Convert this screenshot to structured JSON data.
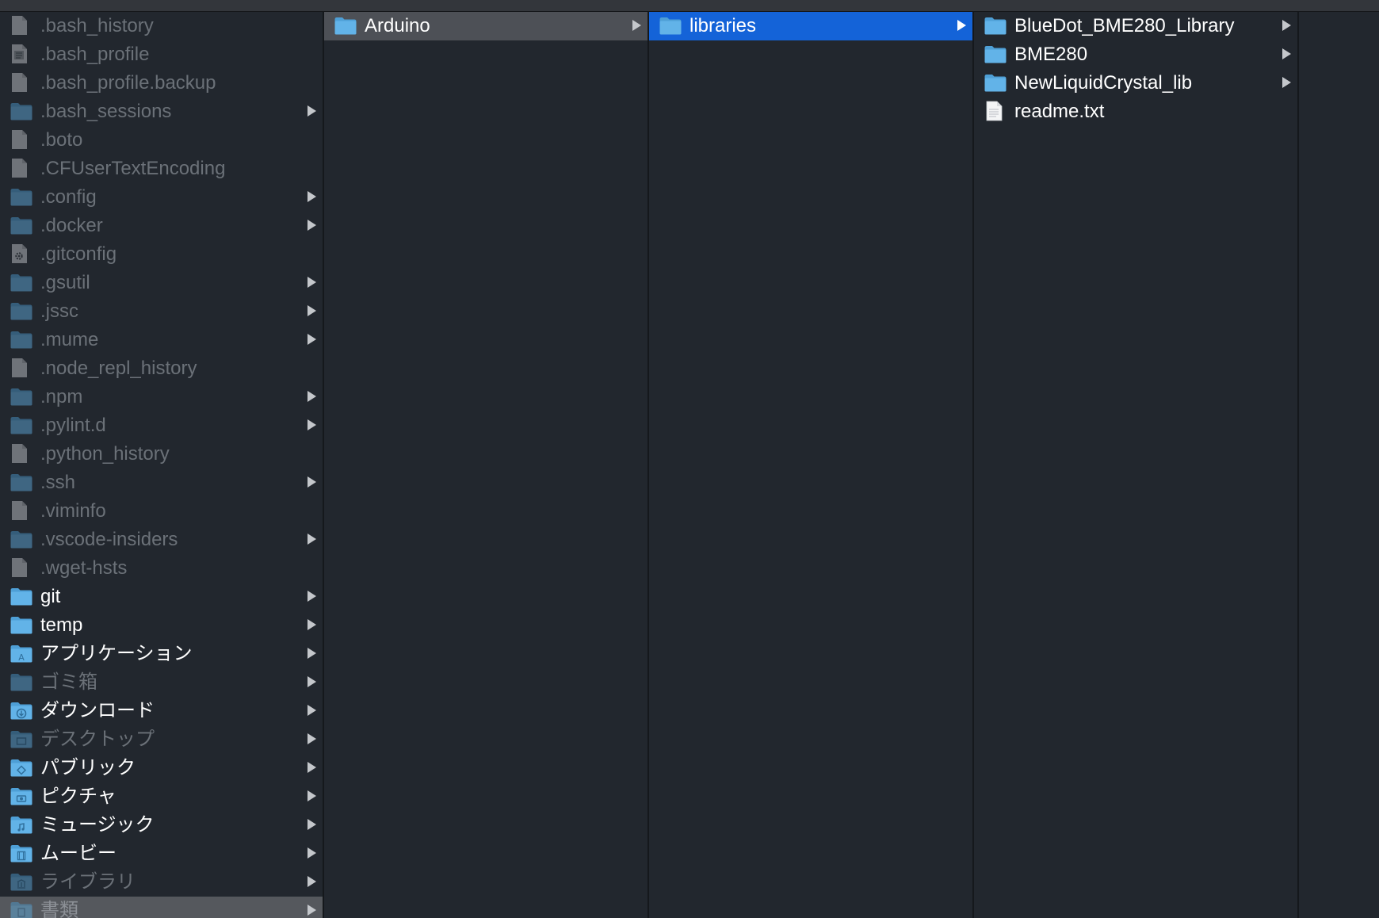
{
  "columns": [
    {
      "items": [
        {
          "name": ".bash_history",
          "kind": "doc",
          "hidden": true,
          "arrow": false
        },
        {
          "name": ".bash_profile",
          "kind": "text-doc",
          "hidden": true,
          "arrow": false
        },
        {
          "name": ".bash_profile.backup",
          "kind": "doc",
          "hidden": true,
          "arrow": false
        },
        {
          "name": ".bash_sessions",
          "kind": "folder",
          "hidden": true,
          "arrow": true
        },
        {
          "name": ".boto",
          "kind": "doc",
          "hidden": true,
          "arrow": false
        },
        {
          "name": ".CFUserTextEncoding",
          "kind": "doc",
          "hidden": true,
          "arrow": false
        },
        {
          "name": ".config",
          "kind": "folder",
          "hidden": true,
          "arrow": true
        },
        {
          "name": ".docker",
          "kind": "folder",
          "hidden": true,
          "arrow": true
        },
        {
          "name": ".gitconfig",
          "kind": "gear-doc",
          "hidden": true,
          "arrow": false
        },
        {
          "name": ".gsutil",
          "kind": "folder",
          "hidden": true,
          "arrow": true
        },
        {
          "name": ".jssc",
          "kind": "folder",
          "hidden": true,
          "arrow": true
        },
        {
          "name": ".mume",
          "kind": "folder",
          "hidden": true,
          "arrow": true
        },
        {
          "name": ".node_repl_history",
          "kind": "doc",
          "hidden": true,
          "arrow": false
        },
        {
          "name": ".npm",
          "kind": "folder",
          "hidden": true,
          "arrow": true
        },
        {
          "name": ".pylint.d",
          "kind": "folder",
          "hidden": true,
          "arrow": true
        },
        {
          "name": ".python_history",
          "kind": "doc",
          "hidden": true,
          "arrow": false
        },
        {
          "name": ".ssh",
          "kind": "folder",
          "hidden": true,
          "arrow": true
        },
        {
          "name": ".viminfo",
          "kind": "doc",
          "hidden": true,
          "arrow": false
        },
        {
          "name": ".vscode-insiders",
          "kind": "folder",
          "hidden": true,
          "arrow": true
        },
        {
          "name": ".wget-hsts",
          "kind": "doc",
          "hidden": true,
          "arrow": false
        },
        {
          "name": "git",
          "kind": "folder",
          "hidden": false,
          "arrow": true
        },
        {
          "name": "temp",
          "kind": "folder",
          "hidden": false,
          "arrow": true
        },
        {
          "name": "アプリケーション",
          "kind": "folder-apps",
          "hidden": false,
          "arrow": true
        },
        {
          "name": "ゴミ箱",
          "kind": "folder",
          "hidden": true,
          "arrow": true
        },
        {
          "name": "ダウンロード",
          "kind": "folder-downloads",
          "hidden": false,
          "arrow": true
        },
        {
          "name": "デスクトップ",
          "kind": "folder-desktop",
          "hidden": true,
          "arrow": true
        },
        {
          "name": "パブリック",
          "kind": "folder-public",
          "hidden": false,
          "arrow": true
        },
        {
          "name": "ピクチャ",
          "kind": "folder-pictures",
          "hidden": false,
          "arrow": true
        },
        {
          "name": "ミュージック",
          "kind": "folder-music",
          "hidden": false,
          "arrow": true
        },
        {
          "name": "ムービー",
          "kind": "folder-movies",
          "hidden": false,
          "arrow": true
        },
        {
          "name": "ライブラリ",
          "kind": "folder-library",
          "hidden": true,
          "arrow": true
        },
        {
          "name": "書類",
          "kind": "folder-documents",
          "hidden": true,
          "arrow": true,
          "selected": "bottom"
        }
      ]
    },
    {
      "items": [
        {
          "name": "Arduino",
          "kind": "folder",
          "hidden": false,
          "arrow": true,
          "selected": "gray"
        }
      ]
    },
    {
      "items": [
        {
          "name": "libraries",
          "kind": "folder",
          "hidden": false,
          "arrow": true,
          "selected": "blue"
        }
      ]
    },
    {
      "items": [
        {
          "name": "BlueDot_BME280_Library",
          "kind": "folder",
          "hidden": false,
          "arrow": true
        },
        {
          "name": "BME280",
          "kind": "folder",
          "hidden": false,
          "arrow": true
        },
        {
          "name": "NewLiquidCrystal_lib",
          "kind": "folder",
          "hidden": false,
          "arrow": true
        },
        {
          "name": "readme.txt",
          "kind": "text-file",
          "hidden": false,
          "arrow": false
        }
      ]
    },
    {
      "items": []
    }
  ],
  "colors": {
    "folder": "#62b3e8",
    "folder_tab": "#4e9fd6",
    "selection_blue": "#1463d8",
    "selection_gray": "#4d5056",
    "background": "#22272e"
  }
}
